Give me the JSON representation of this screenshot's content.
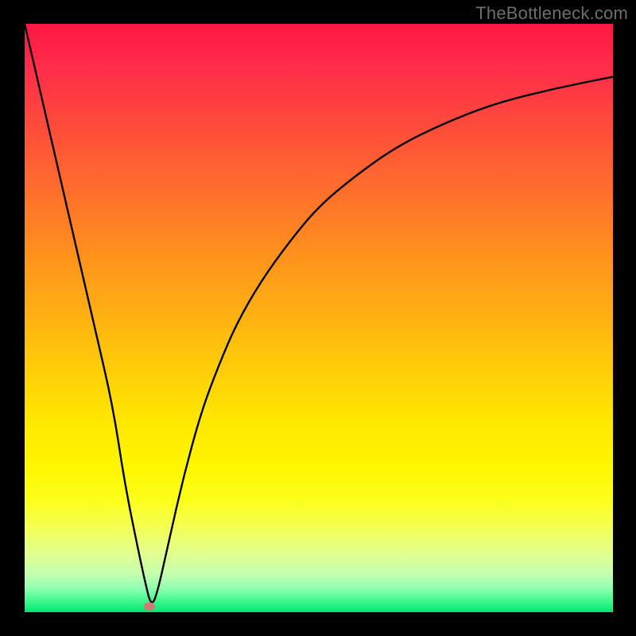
{
  "watermark": "TheBottleneck.com",
  "chart_data": {
    "type": "line",
    "title": "",
    "xlabel": "",
    "ylabel": "",
    "xlim": [
      0,
      100
    ],
    "ylim": [
      0,
      100
    ],
    "grid": false,
    "series": [
      {
        "name": "bottleneck-curve",
        "x": [
          0,
          3,
          6,
          9,
          12,
          15,
          17,
          19,
          20.5,
          21.5,
          22.5,
          24.5,
          27,
          30,
          33,
          36,
          40,
          45,
          50,
          56,
          63,
          71,
          80,
          90,
          100
        ],
        "y": [
          100,
          87,
          74,
          61,
          48,
          35,
          22,
          12,
          5,
          1,
          3,
          12,
          23,
          34,
          42,
          49,
          56,
          63,
          69,
          74,
          79,
          83,
          86.5,
          89,
          91
        ]
      }
    ],
    "marker": {
      "x": 21.2,
      "y": 0.9
    },
    "background_gradient": {
      "top": "#ff1744",
      "middle": "#ffe600",
      "bottom": "#00e676"
    }
  },
  "colors": {
    "frame": "#000000",
    "curve": "#000000",
    "marker": "#cf7a76",
    "watermark": "#6d6d6d"
  }
}
